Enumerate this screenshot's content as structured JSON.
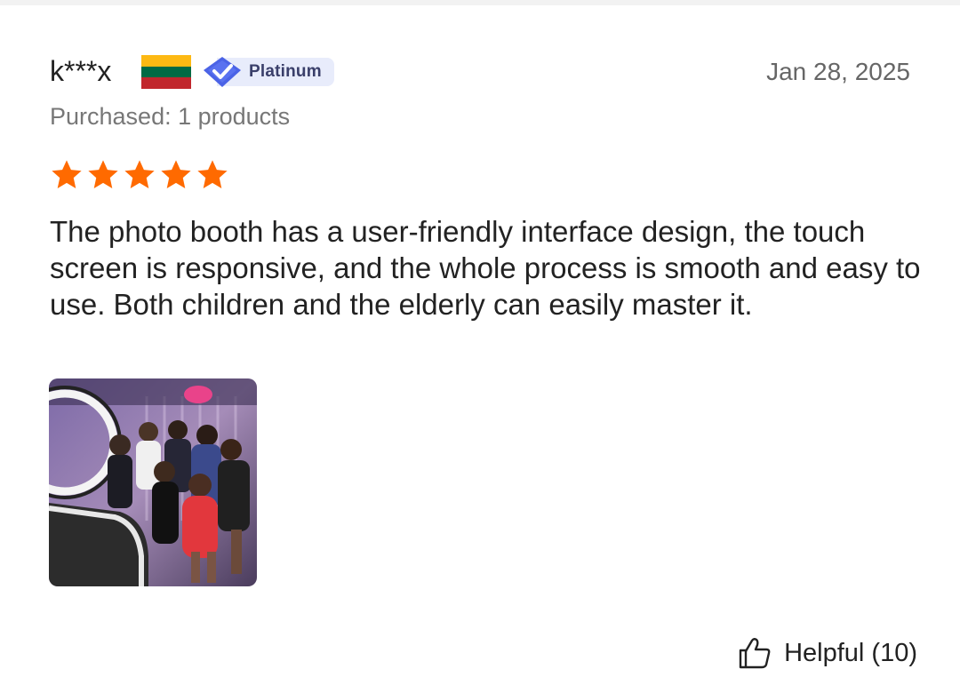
{
  "review": {
    "username": "k***x",
    "flag_colors": [
      "#FDB913",
      "#006A44",
      "#C1272D"
    ],
    "badge": {
      "label": "Platinum",
      "icon": "diamond-check-icon",
      "color": "#4b63e6"
    },
    "date": "Jan 28, 2025",
    "purchased": "Purchased: 1 products",
    "rating": {
      "value": 5,
      "max": 5,
      "color": "#ff6a00"
    },
    "text": "The photo booth has a user-friendly interface design, the touch screen is responsive, and the whole process is smooth and easy to use. Both children and the elderly can easily master it.",
    "photo": {
      "icon": "review-photo-thumbnail"
    },
    "helpful": {
      "label": "Helpful (10)",
      "icon": "thumbs-up-icon"
    }
  }
}
